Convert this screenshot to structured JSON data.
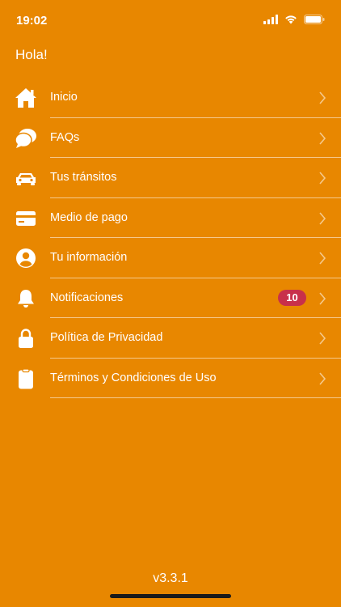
{
  "status_bar": {
    "time": "19:02",
    "icons": [
      "signal-icon",
      "wifi-icon",
      "battery-icon"
    ]
  },
  "greeting": "Hola!",
  "menu": {
    "items": [
      {
        "label": "Inicio",
        "icon": "home-icon"
      },
      {
        "label": "FAQs",
        "icon": "chat-bubbles-icon"
      },
      {
        "label": "Tus tránsitos",
        "icon": "car-icon"
      },
      {
        "label": "Medio de pago",
        "icon": "credit-card-icon"
      },
      {
        "label": "Tu información",
        "icon": "user-circle-icon"
      },
      {
        "label": "Notificaciones",
        "icon": "bell-icon",
        "badge": "10"
      },
      {
        "label": "Política de Privacidad",
        "icon": "lock-icon"
      },
      {
        "label": "Términos y Condiciones de Uso",
        "icon": "clipboard-icon"
      }
    ]
  },
  "version": "v3.3.1",
  "colors": {
    "background": "#E88700",
    "badge": "#C8304A",
    "text": "#FFFFFF"
  }
}
